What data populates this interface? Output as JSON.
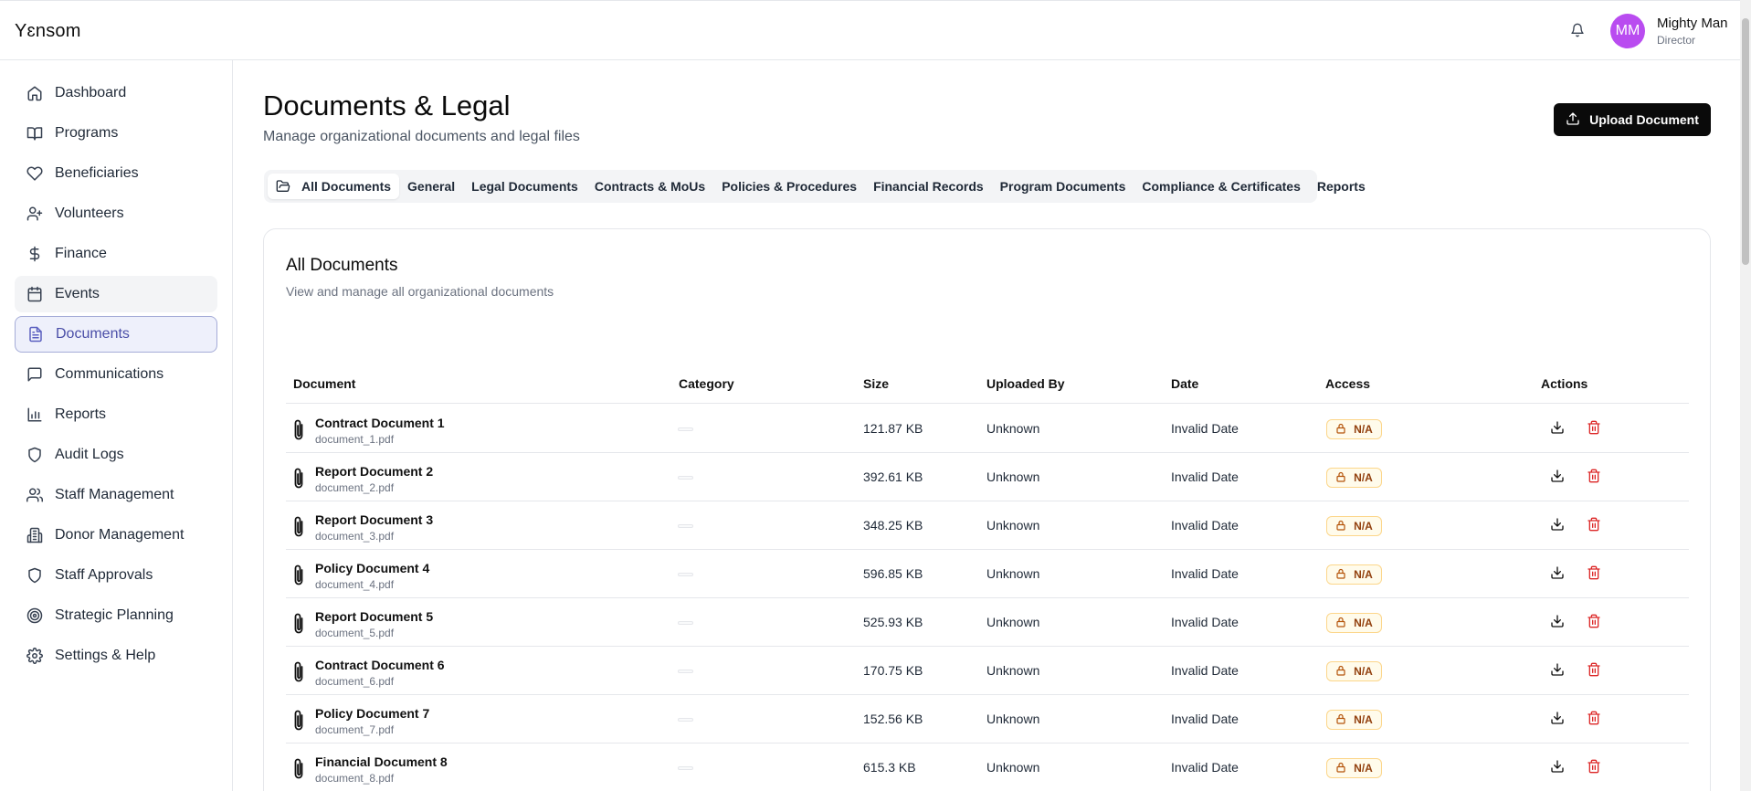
{
  "app": {
    "logo": "Yɛnsom"
  },
  "header": {
    "user": {
      "initials": "MM",
      "name": "Mighty Man",
      "role": "Director"
    }
  },
  "sidebar": {
    "items": [
      {
        "label": "Dashboard",
        "icon": "home-icon"
      },
      {
        "label": "Programs",
        "icon": "book-open-icon"
      },
      {
        "label": "Beneficiaries",
        "icon": "heart-icon"
      },
      {
        "label": "Volunteers",
        "icon": "user-plus-icon"
      },
      {
        "label": "Finance",
        "icon": "dollar-icon"
      },
      {
        "label": "Events",
        "icon": "calendar-icon"
      },
      {
        "label": "Documents",
        "icon": "file-text-icon"
      },
      {
        "label": "Communications",
        "icon": "message-icon"
      },
      {
        "label": "Reports",
        "icon": "bar-chart-icon"
      },
      {
        "label": "Audit Logs",
        "icon": "shield-icon"
      },
      {
        "label": "Staff Management",
        "icon": "users-icon"
      },
      {
        "label": "Donor Management",
        "icon": "building-icon"
      },
      {
        "label": "Staff Approvals",
        "icon": "shield-icon"
      },
      {
        "label": "Strategic Planning",
        "icon": "target-icon"
      },
      {
        "label": "Settings & Help",
        "icon": "gear-icon"
      }
    ]
  },
  "page": {
    "title": "Documents & Legal",
    "subtitle": "Manage organizational documents and legal files",
    "upload_label": "Upload Document"
  },
  "tabs": [
    "All Documents",
    "General",
    "Legal Documents",
    "Contracts & MoUs",
    "Policies & Procedures",
    "Financial Records",
    "Program Documents",
    "Compliance & Certificates",
    "Reports"
  ],
  "card": {
    "title": "All Documents",
    "subtitle": "View and manage all organizational documents"
  },
  "table": {
    "headers": {
      "document": "Document",
      "category": "Category",
      "size": "Size",
      "uploaded_by": "Uploaded By",
      "date": "Date",
      "access": "Access",
      "actions": "Actions"
    },
    "rows": [
      {
        "name": "Contract Document 1",
        "file": "document_1.pdf",
        "size": "121.87 KB",
        "uploaded_by": "Unknown",
        "date": "Invalid Date",
        "access": "N/A"
      },
      {
        "name": "Report Document 2",
        "file": "document_2.pdf",
        "size": "392.61 KB",
        "uploaded_by": "Unknown",
        "date": "Invalid Date",
        "access": "N/A"
      },
      {
        "name": "Report Document 3",
        "file": "document_3.pdf",
        "size": "348.25 KB",
        "uploaded_by": "Unknown",
        "date": "Invalid Date",
        "access": "N/A"
      },
      {
        "name": "Policy Document 4",
        "file": "document_4.pdf",
        "size": "596.85 KB",
        "uploaded_by": "Unknown",
        "date": "Invalid Date",
        "access": "N/A"
      },
      {
        "name": "Report Document 5",
        "file": "document_5.pdf",
        "size": "525.93 KB",
        "uploaded_by": "Unknown",
        "date": "Invalid Date",
        "access": "N/A"
      },
      {
        "name": "Contract Document 6",
        "file": "document_6.pdf",
        "size": "170.75 KB",
        "uploaded_by": "Unknown",
        "date": "Invalid Date",
        "access": "N/A"
      },
      {
        "name": "Policy Document 7",
        "file": "document_7.pdf",
        "size": "152.56 KB",
        "uploaded_by": "Unknown",
        "date": "Invalid Date",
        "access": "N/A"
      },
      {
        "name": "Financial Document 8",
        "file": "document_8.pdf",
        "size": "615.3 KB",
        "uploaded_by": "Unknown",
        "date": "Invalid Date",
        "access": "N/A"
      }
    ]
  },
  "colors": {
    "accent": "#5a5fc0",
    "avatar": "#b94cf0",
    "danger": "#dc2626",
    "badge_border": "#fcd68a",
    "badge_text": "#92400e"
  }
}
